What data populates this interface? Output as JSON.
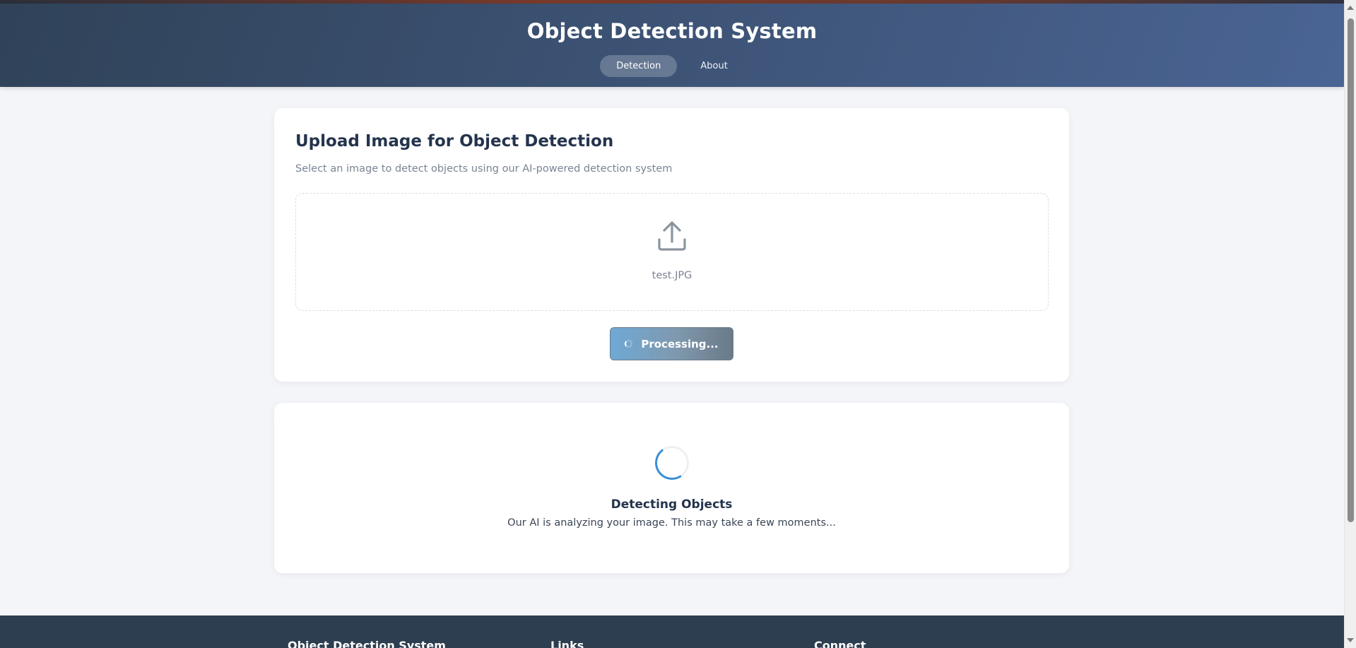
{
  "header": {
    "title": "Object Detection System",
    "tabs": [
      {
        "label": "Detection",
        "active": true
      },
      {
        "label": "About",
        "active": false
      }
    ]
  },
  "upload": {
    "title": "Upload Image for Object Detection",
    "subtitle": "Select an image to detect objects using our AI-powered detection system",
    "dropzone_icon": "upload-icon",
    "file_name": "test.JPG",
    "button_label": "Processing..."
  },
  "status": {
    "title": "Detecting Objects",
    "message": "Our AI is analyzing your image. This may take a few moments..."
  },
  "footer": {
    "columns": [
      {
        "heading": "Object Detection System"
      },
      {
        "heading": "Links"
      },
      {
        "heading": "Connect"
      }
    ]
  },
  "colors": {
    "header_gradient_start": "#2f4258",
    "header_gradient_end": "#4a6494",
    "accent_blue": "#3a8fd8",
    "footer_bg": "#2c3e50",
    "title_text": "#24344d"
  }
}
